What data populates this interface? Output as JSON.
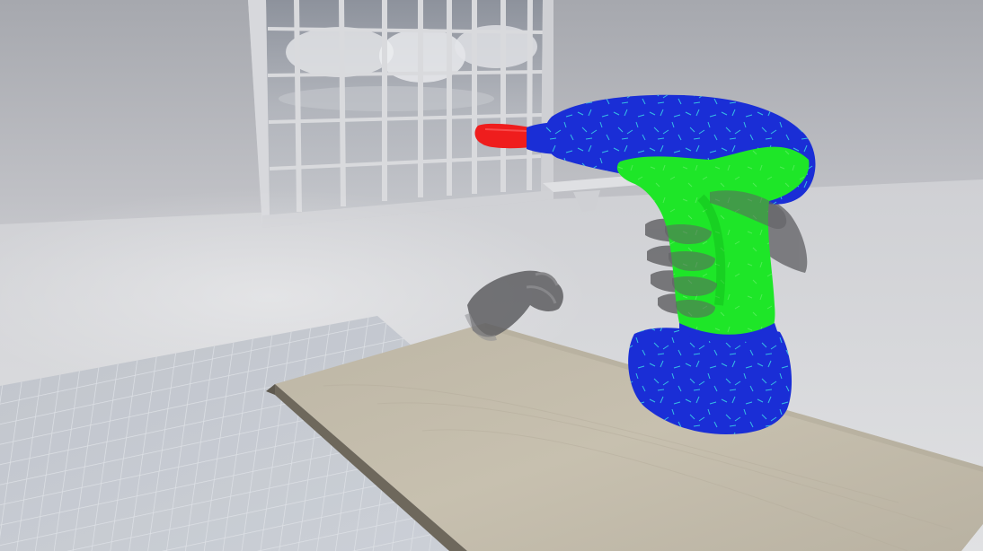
{
  "scene": {
    "type": "vr-viewport",
    "objects": [
      "window",
      "bench",
      "floor-grid",
      "table",
      "left-hand",
      "right-hand",
      "power-drill"
    ]
  },
  "colors": {
    "fog": "#c9cacf",
    "wall": "#b4b5bb",
    "window_frame": "#d7d8dc",
    "sky": "#9ea3ad",
    "table_top": "#c3bcab",
    "table_edge": "#6e685c",
    "grid_floor": "#b7bcc4",
    "grid_lines": "#d9dde3",
    "hand": "#5f5f62",
    "drill_body": "#1a2ed6",
    "drill_grip": "#1ee628",
    "drill_tip": "#ef1d1d",
    "drill_speckle": "#34d7e8"
  }
}
